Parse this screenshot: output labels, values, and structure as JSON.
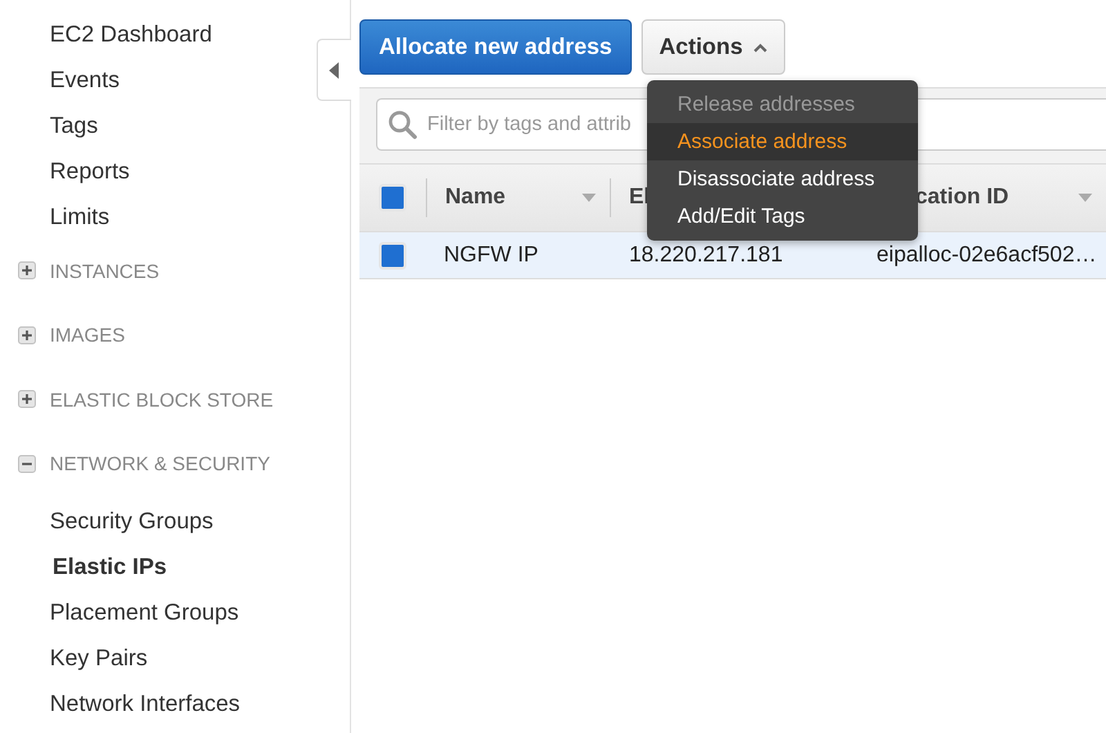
{
  "sidebar": {
    "items": [
      {
        "kind": "link",
        "label": "EC2 Dashboard",
        "selected": false
      },
      {
        "kind": "link",
        "label": "Events",
        "selected": false
      },
      {
        "kind": "link",
        "label": "Tags",
        "selected": false
      },
      {
        "kind": "link",
        "label": "Reports",
        "selected": false
      },
      {
        "kind": "link",
        "label": "Limits",
        "selected": false
      },
      {
        "kind": "section",
        "label": "INSTANCES",
        "expanded": false
      },
      {
        "kind": "section",
        "label": "IMAGES",
        "expanded": false
      },
      {
        "kind": "section",
        "label": "ELASTIC BLOCK STORE",
        "expanded": false
      },
      {
        "kind": "section",
        "label": "NETWORK & SECURITY",
        "expanded": true,
        "children": [
          {
            "kind": "link",
            "label": "Security Groups",
            "selected": false
          },
          {
            "kind": "link",
            "label": "Elastic IPs",
            "selected": true
          },
          {
            "kind": "link",
            "label": "Placement Groups",
            "selected": false
          },
          {
            "kind": "link",
            "label": "Key Pairs",
            "selected": false
          },
          {
            "kind": "link",
            "label": "Network Interfaces",
            "selected": false
          }
        ]
      }
    ]
  },
  "toolbar": {
    "primary_button": "Allocate new address",
    "actions_button": "Actions"
  },
  "actions_menu": {
    "items": [
      {
        "label": "Release addresses",
        "disabled": true,
        "selected": false
      },
      {
        "label": "Associate address",
        "disabled": false,
        "selected": true
      },
      {
        "label": "Disassociate address",
        "disabled": false,
        "selected": false
      },
      {
        "label": "Add/Edit Tags",
        "disabled": false,
        "selected": false
      }
    ]
  },
  "search": {
    "placeholder": "Filter by tags and attrib"
  },
  "table": {
    "all_checked": true,
    "columns": [
      "Name",
      "El",
      "cation ID"
    ],
    "rows": [
      {
        "cells": [
          "NGFW IP",
          "18.220.217.181",
          "eipalloc-02e6acf502…"
        ],
        "selected": true,
        "checked": true
      }
    ]
  }
}
